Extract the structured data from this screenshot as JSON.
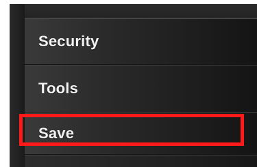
{
  "menu": {
    "items": [
      {
        "label": "Security"
      },
      {
        "label": "Tools"
      },
      {
        "label": "Save"
      }
    ]
  },
  "annotation": {
    "highlight_color": "#ff1a1a"
  }
}
